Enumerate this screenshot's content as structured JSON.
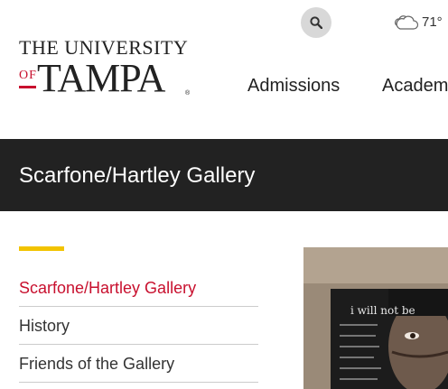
{
  "header": {
    "logo": {
      "line1": "THE UNIVERSITY",
      "of": "OF",
      "tampa": "TAMPA",
      "registered": "®"
    },
    "search_icon": "search-icon",
    "weather": {
      "icon": "cloudy-icon",
      "temperature": "71°"
    },
    "nav": [
      {
        "label": "Admissions"
      },
      {
        "label": "Academ"
      }
    ]
  },
  "banner": {
    "title": "Scarfone/Hartley Gallery"
  },
  "subnav": {
    "items": [
      {
        "label": "Scarfone/Hartley Gallery",
        "active": true
      },
      {
        "label": "History",
        "active": false
      },
      {
        "label": "Friends of the Gallery",
        "active": false
      }
    ]
  },
  "hero": {
    "artwork_text": "i will not be"
  },
  "colors": {
    "brand_red": "#c8102e",
    "banner_bg": "#222222",
    "accent_yellow": "#f2c300"
  }
}
